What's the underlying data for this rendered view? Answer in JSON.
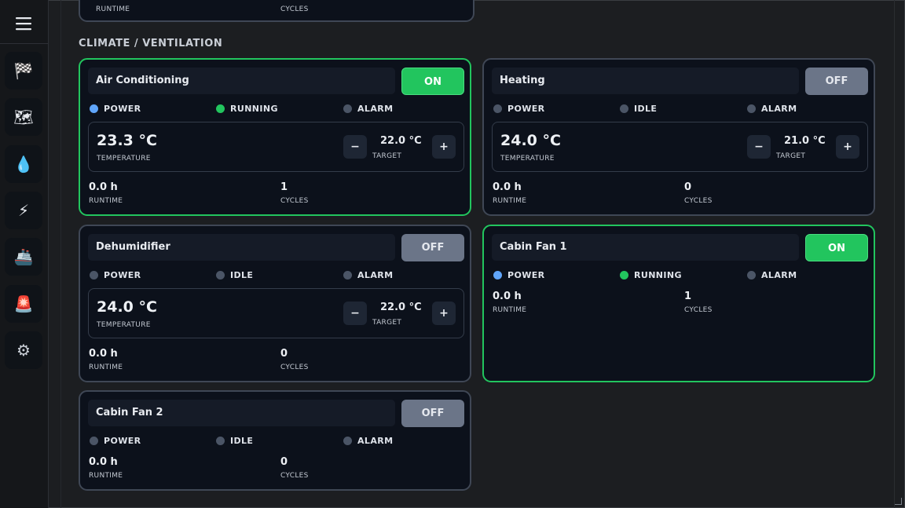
{
  "section_title": "CLIMATE / VENTILATION",
  "nav": {
    "menu_icon": "hamburger-icon",
    "items": [
      {
        "name": "checkered-flag",
        "glyph": "🏁"
      },
      {
        "name": "map",
        "glyph": "🗺"
      },
      {
        "name": "water-drop",
        "glyph": "💧"
      },
      {
        "name": "lightning",
        "glyph": "⚡"
      },
      {
        "name": "ship",
        "glyph": "🚢"
      },
      {
        "name": "alarm-siren",
        "glyph": "🚨"
      },
      {
        "name": "gear",
        "glyph": "⚙"
      }
    ]
  },
  "partial_card": {
    "runtime_label": "RUNTIME",
    "cycles_label": "CYCLES"
  },
  "labels": {
    "power": "POWER",
    "alarm": "ALARM",
    "running": "RUNNING",
    "idle": "IDLE",
    "temperature": "TEMPERATURE",
    "target": "TARGET",
    "runtime": "RUNTIME",
    "cycles": "CYCLES",
    "minus": "−",
    "plus": "+"
  },
  "cards": {
    "air_conditioning": {
      "title": "Air Conditioning",
      "state": "ON",
      "status": "RUNNING",
      "temperature": "23.3 °C",
      "target": "22.0 °C",
      "runtime": "0.0 h",
      "cycles": "1"
    },
    "heating": {
      "title": "Heating",
      "state": "OFF",
      "status": "IDLE",
      "temperature": "24.0 °C",
      "target": "21.0 °C",
      "runtime": "0.0 h",
      "cycles": "0"
    },
    "dehumidifier": {
      "title": "Dehumidifier",
      "state": "OFF",
      "status": "IDLE",
      "temperature": "24.0 °C",
      "target": "22.0 °C",
      "runtime": "0.0 h",
      "cycles": "0"
    },
    "cabin_fan_1": {
      "title": "Cabin Fan 1",
      "state": "ON",
      "status": "RUNNING",
      "runtime": "0.0 h",
      "cycles": "1"
    },
    "cabin_fan_2": {
      "title": "Cabin Fan 2",
      "state": "OFF",
      "status": "IDLE",
      "runtime": "0.0 h",
      "cycles": "0"
    }
  },
  "colors": {
    "on": "#22c55e",
    "off": "#6b7588",
    "power": "#60a5fa",
    "inactive": "#4b5566"
  }
}
